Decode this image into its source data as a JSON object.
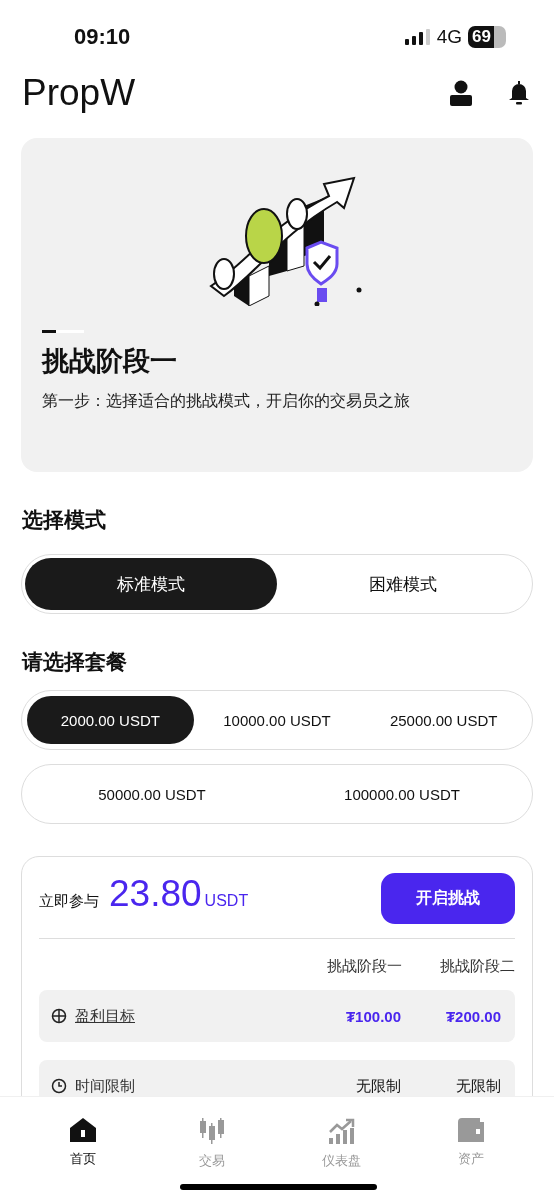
{
  "status_bar": {
    "time": "09:10",
    "network": "4G",
    "battery": "69"
  },
  "header": {
    "title": "PropW"
  },
  "hero": {
    "title": "挑战阶段一",
    "subtitle": "第一步：选择适合的挑战模式，开启你的交易员之旅"
  },
  "mode_section": {
    "title": "选择模式",
    "modes": [
      {
        "label": "标准模式",
        "selected": true
      },
      {
        "label": "困难模式",
        "selected": false
      }
    ]
  },
  "package_section": {
    "title": "请选择套餐",
    "rows": [
      {
        "options": [
          {
            "label": "2000.00 USDT",
            "selected": true
          },
          {
            "label": "10000.00 USDT",
            "selected": false
          },
          {
            "label": "25000.00 USDT",
            "selected": false
          }
        ]
      },
      {
        "options": [
          {
            "label": "50000.00 USDT",
            "selected": false
          },
          {
            "label": "100000.00 USDT",
            "selected": false
          }
        ]
      }
    ]
  },
  "summary": {
    "join_label": "立即参与",
    "price": "23.80",
    "currency": "USDT",
    "start_button": "开启挑战",
    "columns": [
      "挑战阶段一",
      "挑战阶段二"
    ],
    "rows": [
      {
        "kind": "target",
        "label": "盈利目标",
        "link": true,
        "values": [
          "₮100.00",
          "₮200.00"
        ]
      },
      {
        "kind": "clock",
        "label": "时间限制",
        "link": false,
        "values": [
          "无限制",
          "无限制"
        ]
      }
    ]
  },
  "tab_bar": [
    {
      "kind": "home",
      "label": "首页",
      "selected": true
    },
    {
      "kind": "candles",
      "label": "交易",
      "selected": false
    },
    {
      "kind": "growth",
      "label": "仪表盘",
      "selected": false
    },
    {
      "kind": "wallet",
      "label": "资产",
      "selected": false
    }
  ]
}
